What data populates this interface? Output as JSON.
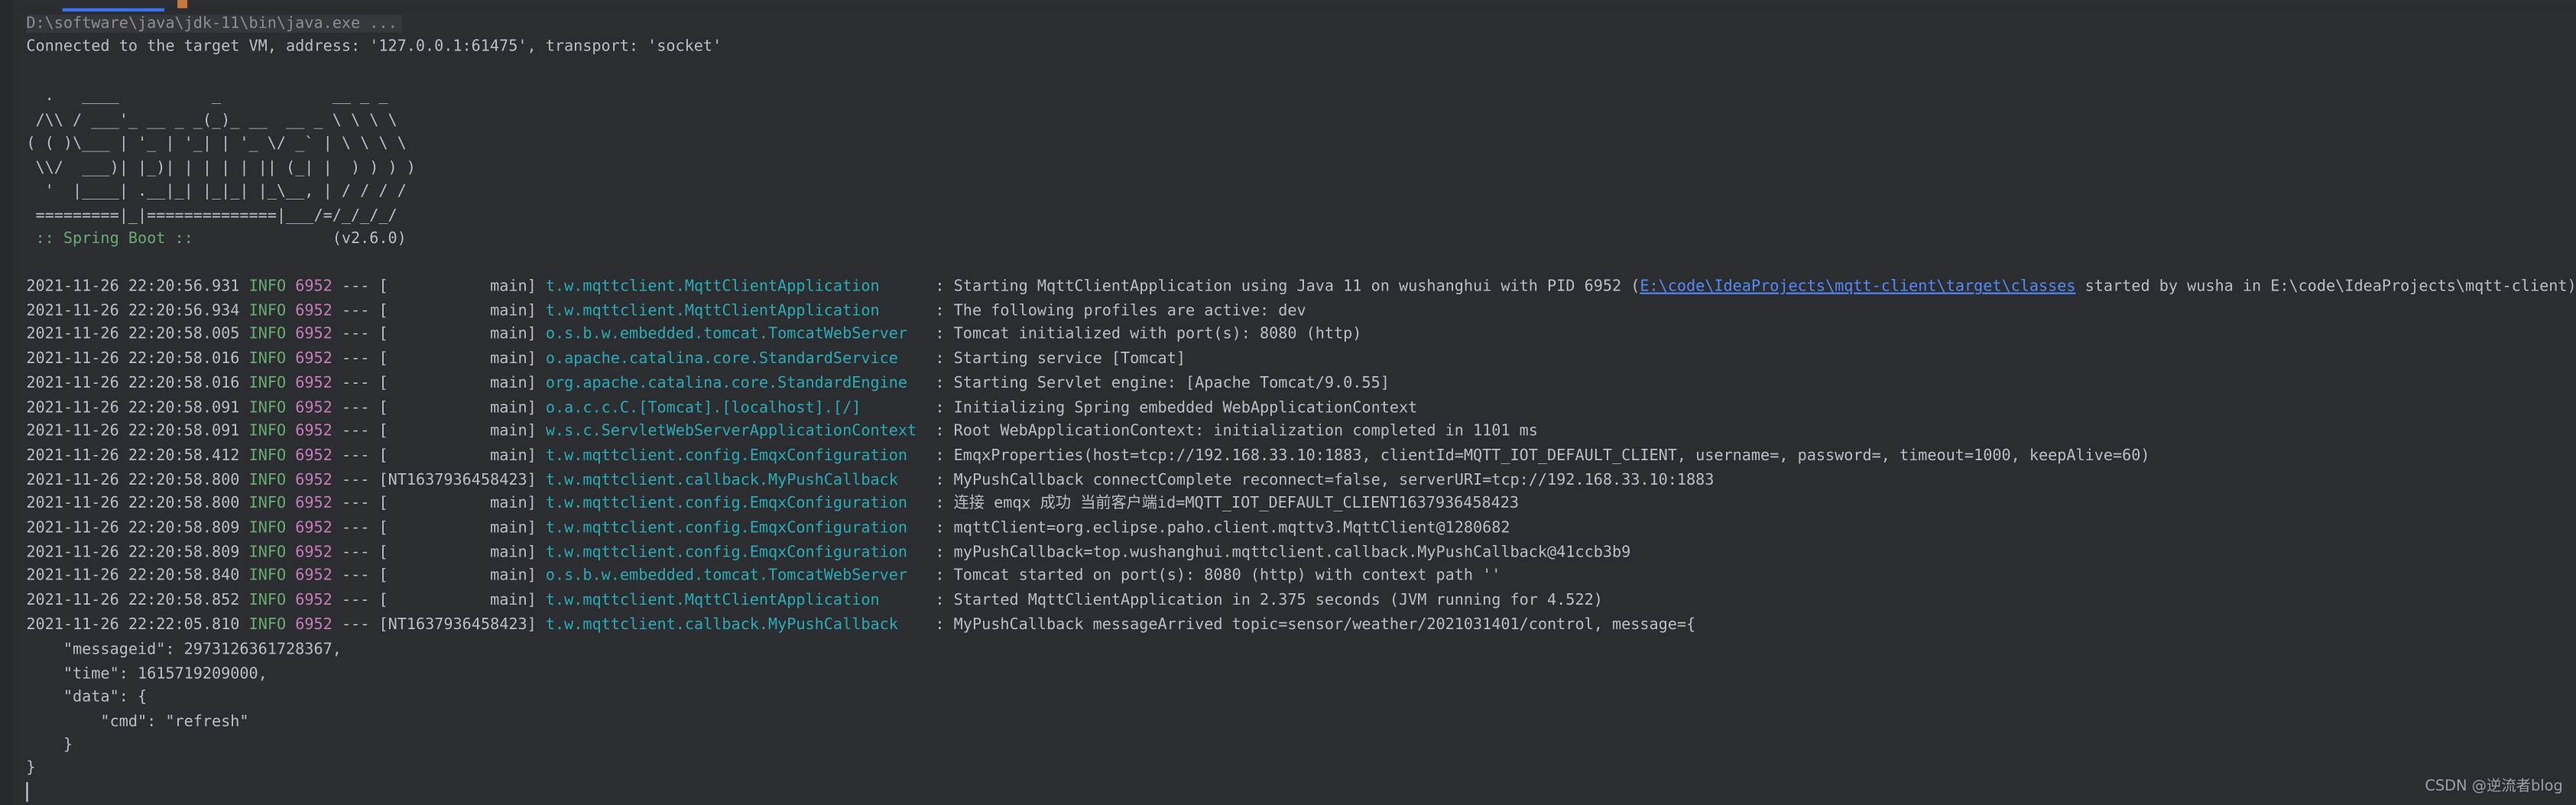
{
  "console": {
    "command": "D:\\software\\java\\jdk-11\\bin\\java.exe ...",
    "connected": "Connected to the target VM, address: '127.0.0.1:61475', transport: 'socket'",
    "banner": [
      "  .   ____          _            __ _ _",
      " /\\\\ / ___'_ __ _ _(_)_ __  __ _ \\ \\ \\ \\",
      "( ( )\\___ | '_ | '_| | '_ \\/ _` | \\ \\ \\ \\",
      " \\\\/  ___)| |_)| | | | | || (_| |  ) ) ) )",
      "  '  |____| .__|_| |_|_| |_\\__, | / / / /",
      " =========|_|==============|___/=/_/_/_/"
    ],
    "spring_label": " :: Spring Boot :: ",
    "spring_version": "              (v2.6.0)",
    "logs": [
      {
        "ts": "2021-11-26 22:20:56.931",
        "level": "INFO",
        "pid": "6952",
        "sep": "---",
        "thread": "[           main]",
        "logger": "t.w.mqttclient.MqttClientApplication    ",
        "msg": ": Starting MqttClientApplication using Java 11 on wushanghui with PID 6952 (",
        "link": "E:\\code\\IdeaProjects\\mqtt-client\\target\\classes",
        "tail": " started by wusha in E:\\code\\IdeaProjects\\mqtt-client)"
      },
      {
        "ts": "2021-11-26 22:20:56.934",
        "level": "INFO",
        "pid": "6952",
        "sep": "---",
        "thread": "[           main]",
        "logger": "t.w.mqttclient.MqttClientApplication    ",
        "msg": ": The following profiles are active: dev"
      },
      {
        "ts": "2021-11-26 22:20:58.005",
        "level": "INFO",
        "pid": "6952",
        "sep": "---",
        "thread": "[           main]",
        "logger": "o.s.b.w.embedded.tomcat.TomcatWebServer ",
        "msg": ": Tomcat initialized with port(s): 8080 (http)"
      },
      {
        "ts": "2021-11-26 22:20:58.016",
        "level": "INFO",
        "pid": "6952",
        "sep": "---",
        "thread": "[           main]",
        "logger": "o.apache.catalina.core.StandardService  ",
        "msg": ": Starting service [Tomcat]"
      },
      {
        "ts": "2021-11-26 22:20:58.016",
        "level": "INFO",
        "pid": "6952",
        "sep": "---",
        "thread": "[           main]",
        "logger": "org.apache.catalina.core.StandardEngine ",
        "msg": ": Starting Servlet engine: [Apache Tomcat/9.0.55]"
      },
      {
        "ts": "2021-11-26 22:20:58.091",
        "level": "INFO",
        "pid": "6952",
        "sep": "---",
        "thread": "[           main]",
        "logger": "o.a.c.c.C.[Tomcat].[localhost].[/]      ",
        "msg": ": Initializing Spring embedded WebApplicationContext"
      },
      {
        "ts": "2021-11-26 22:20:58.091",
        "level": "INFO",
        "pid": "6952",
        "sep": "---",
        "thread": "[           main]",
        "logger": "w.s.c.ServletWebServerApplicationContext",
        "msg": ": Root WebApplicationContext: initialization completed in 1101 ms"
      },
      {
        "ts": "2021-11-26 22:20:58.412",
        "level": "INFO",
        "pid": "6952",
        "sep": "---",
        "thread": "[           main]",
        "logger": "t.w.mqttclient.config.EmqxConfiguration ",
        "msg": ": EmqxProperties(host=tcp://192.168.33.10:1883, clientId=MQTT_IOT_DEFAULT_CLIENT, username=, password=, timeout=1000, keepAlive=60)"
      },
      {
        "ts": "2021-11-26 22:20:58.800",
        "level": "INFO",
        "pid": "6952",
        "sep": "---",
        "thread": "[NT1637936458423]",
        "logger": "t.w.mqttclient.callback.MyPushCallback  ",
        "msg": ": MyPushCallback connectComplete reconnect=false, serverURI=tcp://192.168.33.10:1883"
      },
      {
        "ts": "2021-11-26 22:20:58.800",
        "level": "INFO",
        "pid": "6952",
        "sep": "---",
        "thread": "[           main]",
        "logger": "t.w.mqttclient.config.EmqxConfiguration ",
        "msg": ": 连接 emqx 成功 当前客户端id=MQTT_IOT_DEFAULT_CLIENT1637936458423"
      },
      {
        "ts": "2021-11-26 22:20:58.809",
        "level": "INFO",
        "pid": "6952",
        "sep": "---",
        "thread": "[           main]",
        "logger": "t.w.mqttclient.config.EmqxConfiguration ",
        "msg": ": mqttClient=org.eclipse.paho.client.mqttv3.MqttClient@1280682"
      },
      {
        "ts": "2021-11-26 22:20:58.809",
        "level": "INFO",
        "pid": "6952",
        "sep": "---",
        "thread": "[           main]",
        "logger": "t.w.mqttclient.config.EmqxConfiguration ",
        "msg": ": myPushCallback=top.wushanghui.mqttclient.callback.MyPushCallback@41ccb3b9"
      },
      {
        "ts": "2021-11-26 22:20:58.840",
        "level": "INFO",
        "pid": "6952",
        "sep": "---",
        "thread": "[           main]",
        "logger": "o.s.b.w.embedded.tomcat.TomcatWebServer ",
        "msg": ": Tomcat started on port(s): 8080 (http) with context path ''"
      },
      {
        "ts": "2021-11-26 22:20:58.852",
        "level": "INFO",
        "pid": "6952",
        "sep": "---",
        "thread": "[           main]",
        "logger": "t.w.mqttclient.MqttClientApplication    ",
        "msg": ": Started MqttClientApplication in 2.375 seconds (JVM running for 4.522)"
      },
      {
        "ts": "2021-11-26 22:22:05.810",
        "level": "INFO",
        "pid": "6952",
        "sep": "---",
        "thread": "[NT1637936458423]",
        "logger": "t.w.mqttclient.callback.MyPushCallback  ",
        "msg": ": MyPushCallback messageArrived topic=sensor/weather/2021031401/control, message={"
      }
    ],
    "json_lines": [
      "    \"messageid\": 2973126361728367,",
      "    \"time\": 1615719209000,",
      "    \"data\": {",
      "        \"cmd\": \"refresh\"",
      "    }",
      "}"
    ]
  },
  "watermark": "CSDN @逆流者blog"
}
